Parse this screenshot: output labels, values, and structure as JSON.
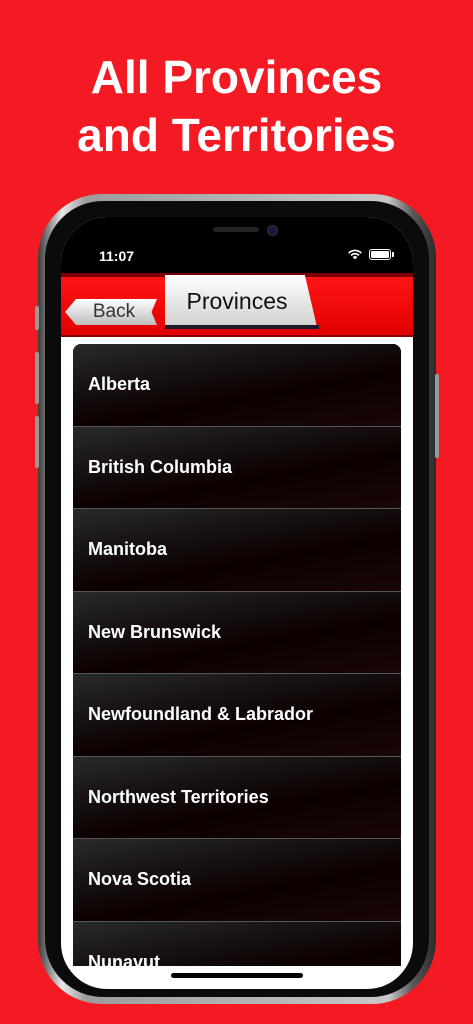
{
  "promo": {
    "headline_line1": "All Provinces",
    "headline_line2": "and Territories"
  },
  "status_bar": {
    "time": "11:07",
    "icons": [
      "wifi-icon",
      "battery-icon"
    ]
  },
  "nav": {
    "back_label": "Back",
    "title": "Provinces",
    "color": "#ff0d0d"
  },
  "list": {
    "items": [
      {
        "label": "Alberta"
      },
      {
        "label": "British Columbia"
      },
      {
        "label": "Manitoba"
      },
      {
        "label": "New Brunswick"
      },
      {
        "label": "Newfoundland & Labrador"
      },
      {
        "label": "Northwest Territories"
      },
      {
        "label": "Nova Scotia"
      },
      {
        "label": "Nunavut"
      }
    ]
  },
  "colors": {
    "background": "#f41a24",
    "row_text": "#ffffff"
  }
}
